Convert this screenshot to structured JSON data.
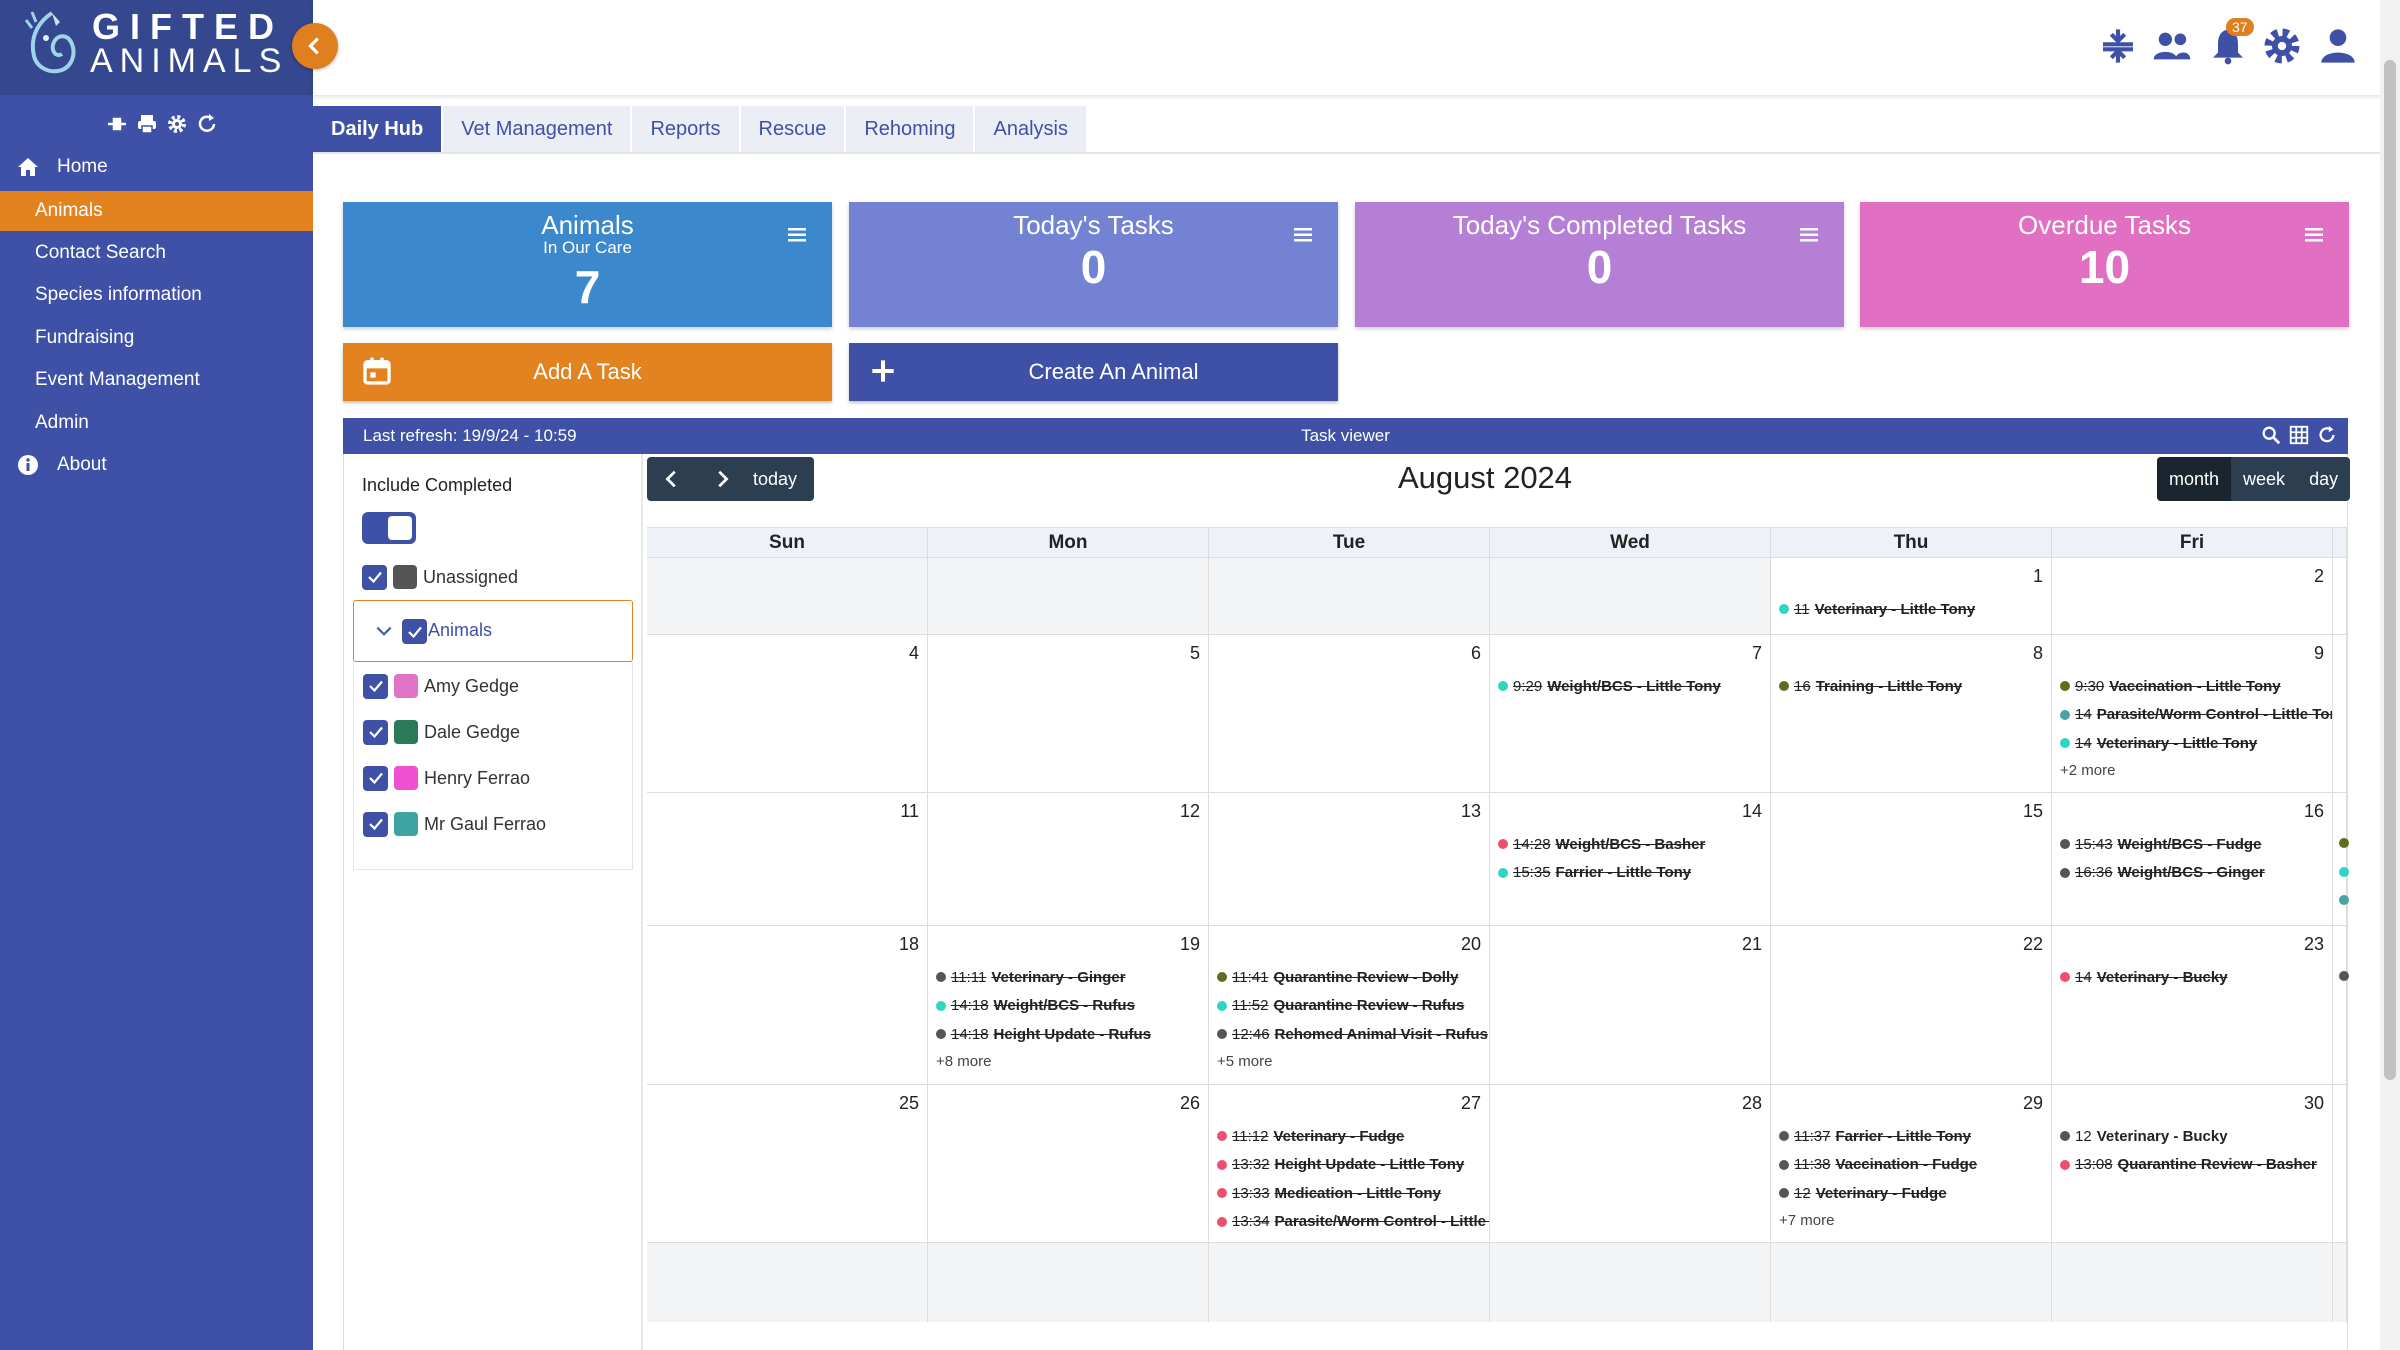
{
  "app": {
    "logo_line1": "GIFTED",
    "logo_line2": "ANIMALS"
  },
  "sidebar": {
    "items": [
      {
        "label": "Home",
        "icon": "home-icon"
      },
      {
        "label": "Animals",
        "active": true
      },
      {
        "label": "Contact Search"
      },
      {
        "label": "Species information"
      },
      {
        "label": "Fundraising"
      },
      {
        "label": "Event Management"
      },
      {
        "label": "Admin"
      },
      {
        "label": "About",
        "icon": "info-icon"
      }
    ]
  },
  "topbar": {
    "notification_count": "37"
  },
  "tabs": [
    "Daily Hub",
    "Vet Management",
    "Reports",
    "Rescue",
    "Rehoming",
    "Analysis"
  ],
  "cards": [
    {
      "title": "Animals",
      "subtitle": "In Our Care",
      "value": "7",
      "color": "#3b88cc"
    },
    {
      "title": "Today's Tasks",
      "subtitle": "",
      "value": "0",
      "color": "#7482d4"
    },
    {
      "title": "Today's Completed Tasks",
      "subtitle": "",
      "value": "0",
      "color": "#b57fd6"
    },
    {
      "title": "Overdue Tasks",
      "subtitle": "",
      "value": "10",
      "color": "#e16fc2"
    }
  ],
  "actions": {
    "add_task": "Add A Task",
    "create_animal": "Create An Animal"
  },
  "viewer": {
    "last_refresh": "Last refresh: 19/9/24 - 10:59",
    "title": "Task viewer"
  },
  "filters": {
    "include_completed": "Include Completed",
    "unassigned": "Unassigned",
    "group": "Animals",
    "people": [
      {
        "name": "Amy Gedge",
        "color": "#e174c7"
      },
      {
        "name": "Dale Gedge",
        "color": "#2a7a5a"
      },
      {
        "name": "Henry Ferrao",
        "color": "#f04fd2"
      },
      {
        "name": "Mr Gaul Ferrao",
        "color": "#3fa3a3"
      }
    ]
  },
  "calendar": {
    "title": "August 2024",
    "today_label": "today",
    "views": [
      "month",
      "week",
      "day"
    ],
    "days_of_week": [
      "Sun",
      "Mon",
      "Tue",
      "Wed",
      "Thu",
      "Fri"
    ],
    "weeks": [
      [
        {
          "num": "",
          "events": []
        },
        {
          "num": "",
          "events": []
        },
        {
          "num": "",
          "events": []
        },
        {
          "num": "",
          "events": []
        },
        {
          "num": "1",
          "events": [
            {
              "time": "11",
              "name": "Veterinary - Little Tony",
              "color": "#2fd5c0",
              "done": true
            }
          ]
        },
        {
          "num": "2",
          "events": []
        }
      ],
      [
        {
          "num": "4",
          "events": []
        },
        {
          "num": "5",
          "events": []
        },
        {
          "num": "6",
          "events": []
        },
        {
          "num": "7",
          "events": [
            {
              "time": "9:29",
              "name": "Weight/BCS - Little Tony",
              "color": "#2fd5c0",
              "done": true
            }
          ]
        },
        {
          "num": "8",
          "events": [
            {
              "time": "16",
              "name": "Training - Little Tony",
              "color": "#5f6d1e",
              "done": true
            }
          ]
        },
        {
          "num": "9",
          "events": [
            {
              "time": "9:30",
              "name": "Vaccination - Little Tony",
              "color": "#5f6d1e",
              "done": true
            },
            {
              "time": "14",
              "name": "Parasite/Worm Control - Little Tony",
              "color": "#4aa3a0",
              "done": true
            },
            {
              "time": "14",
              "name": "Veterinary - Little Tony",
              "color": "#2fd5c0",
              "done": true
            }
          ],
          "more": "+2 more"
        }
      ],
      [
        {
          "num": "11",
          "events": []
        },
        {
          "num": "12",
          "events": []
        },
        {
          "num": "13",
          "events": []
        },
        {
          "num": "14",
          "events": [
            {
              "time": "14:28",
              "name": "Weight/BCS - Basher",
              "color": "#ef4f6e",
              "done": true
            },
            {
              "time": "15:35",
              "name": "Farrier - Little Tony",
              "color": "#2fd5c0",
              "done": true
            }
          ]
        },
        {
          "num": "15",
          "events": []
        },
        {
          "num": "16",
          "events": [
            {
              "time": "15:43",
              "name": "Weight/BCS - Fudge",
              "color": "#555555",
              "done": true
            },
            {
              "time": "16:36",
              "name": "Weight/BCS - Ginger",
              "color": "#555555",
              "done": true
            }
          ]
        }
      ],
      [
        {
          "num": "18",
          "events": []
        },
        {
          "num": "19",
          "events": [
            {
              "time": "11:11",
              "name": "Veterinary - Ginger",
              "color": "#555555",
              "done": true
            },
            {
              "time": "14:18",
              "name": "Weight/BCS - Rufus",
              "color": "#2fd5c0",
              "done": true
            },
            {
              "time": "14:18",
              "name": "Height Update - Rufus",
              "color": "#555555",
              "done": true
            }
          ],
          "more": "+8 more"
        },
        {
          "num": "20",
          "events": [
            {
              "time": "11:41",
              "name": "Quarantine Review - Dolly",
              "color": "#5f6d1e",
              "done": true
            },
            {
              "time": "11:52",
              "name": "Quarantine Review - Rufus",
              "color": "#2fd5c0",
              "done": true
            },
            {
              "time": "12:46",
              "name": "Rehomed Animal Visit - Rufus",
              "color": "#555555",
              "done": true
            }
          ],
          "more": "+5 more"
        },
        {
          "num": "21",
          "events": []
        },
        {
          "num": "22",
          "events": []
        },
        {
          "num": "23",
          "events": [
            {
              "time": "14",
              "name": "Veterinary - Bucky",
              "color": "#ef4f6e",
              "done": true
            }
          ]
        }
      ],
      [
        {
          "num": "25",
          "events": []
        },
        {
          "num": "26",
          "events": []
        },
        {
          "num": "27",
          "events": [
            {
              "time": "11:12",
              "name": "Veterinary - Fudge",
              "color": "#ef4f6e",
              "done": true
            },
            {
              "time": "13:32",
              "name": "Height Update - Little Tony",
              "color": "#ef4f6e",
              "done": true
            },
            {
              "time": "13:33",
              "name": "Medication - Little Tony",
              "color": "#ef4f6e",
              "done": true
            },
            {
              "time": "13:34",
              "name": "Parasite/Worm Control - Little Tony",
              "color": "#ef4f6e",
              "done": true
            }
          ]
        },
        {
          "num": "28",
          "events": []
        },
        {
          "num": "29",
          "events": [
            {
              "time": "11:37",
              "name": "Farrier - Little Tony",
              "color": "#555555",
              "done": true
            },
            {
              "time": "11:38",
              "name": "Vaccination - Fudge",
              "color": "#555555",
              "done": true
            },
            {
              "time": "12",
              "name": "Veterinary - Fudge",
              "color": "#555555",
              "done": true
            }
          ],
          "more": "+7 more"
        },
        {
          "num": "30",
          "events": [
            {
              "time": "12",
              "name": "Veterinary - Bucky",
              "color": "#555555",
              "done": false
            },
            {
              "time": "13:08",
              "name": "Quarantine Review - Basher",
              "color": "#ef4f6e",
              "done": true
            }
          ]
        }
      ]
    ]
  }
}
